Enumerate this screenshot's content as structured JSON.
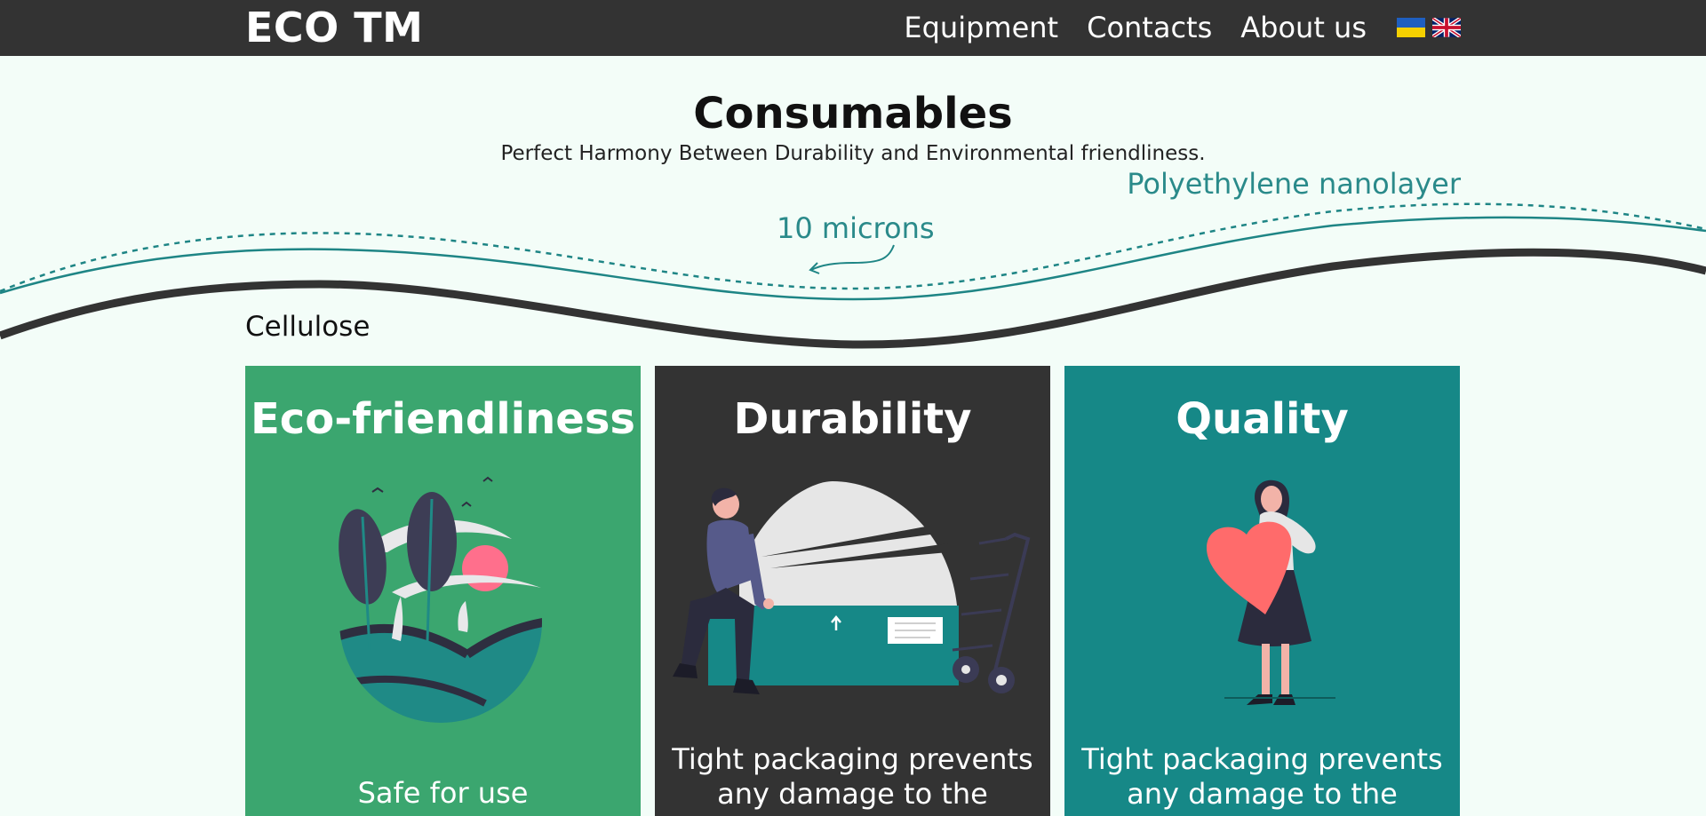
{
  "header": {
    "logo": "ECO TM",
    "nav": [
      "Equipment",
      "Contacts",
      "About us"
    ],
    "languages": [
      "ukrainian-flag-icon",
      "uk-flag-icon"
    ]
  },
  "hero": {
    "title": "Consumables",
    "subtitle": "Perfect Harmony Between Durability and Environmental friendliness."
  },
  "layers": {
    "polyethylene": "Polyethylene nanolayer",
    "thickness": "10 microns",
    "cellulose": "Cellulose"
  },
  "cards": [
    {
      "title": "Eco-friendliness",
      "text": "Safe for use",
      "icon": "nature-illustration"
    },
    {
      "title": "Durability",
      "text": "Tight packaging prevents any damage to the",
      "icon": "box-man-illustration"
    },
    {
      "title": "Quality",
      "text": "Tight packaging prevents any damage to the",
      "icon": "woman-heart-illustration"
    }
  ],
  "colors": {
    "header_bg": "#333333",
    "page_bg": "#f3fdf8",
    "accent_teal": "#2a8a8a",
    "card_green": "#3ba66f",
    "card_dark": "#333333",
    "card_teal": "#168887"
  }
}
